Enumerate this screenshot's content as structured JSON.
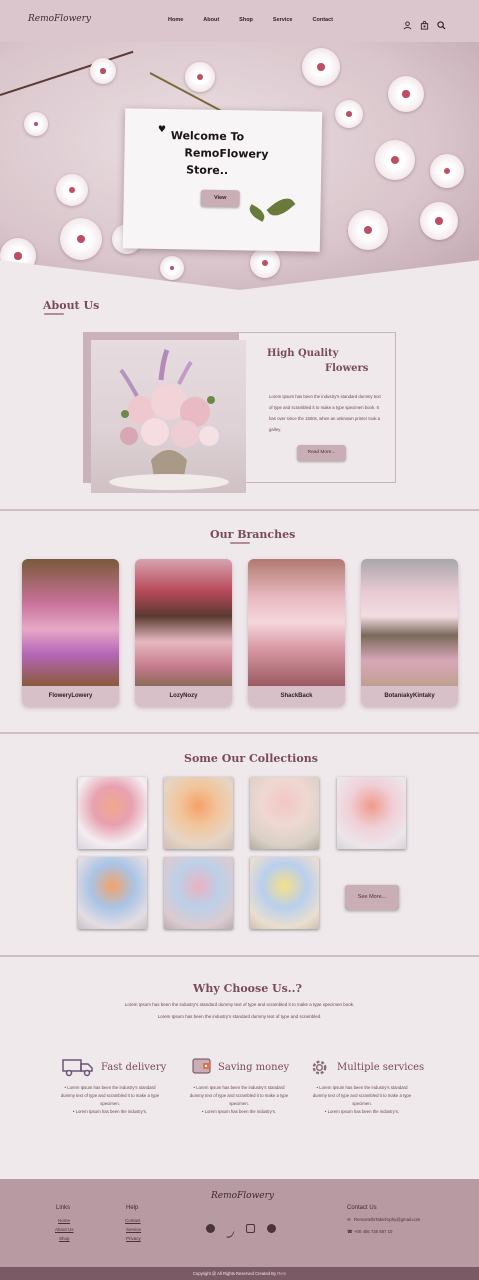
{
  "header": {
    "logo": "RemoFlowery",
    "nav": [
      "Home",
      "About",
      "Shop",
      "Service",
      "Contact"
    ],
    "icons": [
      "user-icon",
      "bag-icon",
      "search-icon"
    ]
  },
  "hero": {
    "welcome_line1": "Welcome To",
    "welcome_line2": "RemoFlowery",
    "welcome_line3": "Store..",
    "view_button": "View"
  },
  "about": {
    "title": "About Us",
    "heading_line1": "High Quality",
    "heading_line2": "Flowers",
    "text": "Lorem Ipsum has been the industry's standard dummy text of type and scrambled it to make a type specimen book. It has over since the 1500s, when an unknown printer took a galley.",
    "read_more": "Read More..."
  },
  "branches": {
    "title": "Our Branches",
    "items": [
      {
        "name": "FloweryLowery"
      },
      {
        "name": "LozyNozy"
      },
      {
        "name": "ShackBack"
      },
      {
        "name": "BotaniakyKintaky"
      }
    ]
  },
  "collections": {
    "title": "Some Our Collections",
    "see_more": "See More..."
  },
  "why": {
    "title": "Why Choose Us..?",
    "desc1": "Lorem Ipsum has been the industry's standard dummy text of type and scrambled it to make a type specimen book.",
    "desc2": "Lorem Ipsum has been the industry's standard dummy text of type and scrambled.",
    "features": [
      {
        "title": "Fast delivery",
        "icon": "truck-icon",
        "point1": "Lorem Ipsum has been the industry's standard dummy text of type and scrambled it to make a type specimen.",
        "point2": "Lorem Ipsum has been the industry's."
      },
      {
        "title": "Saving money",
        "icon": "wallet-icon",
        "point1": "Lorem Ipsum has been the industry's standard dummy text of type and scrambled it to make a type specimen.",
        "point2": "Lorem Ipsum has been the industry's."
      },
      {
        "title": "Multiple services",
        "icon": "gear-icon",
        "point1": "Lorem Ipsum has been the industry's standard dummy text of type and scrambled it to make a type specimen.",
        "point2": "Lorem Ipsum has been the industry's."
      }
    ]
  },
  "footer": {
    "logo": "RemoFlowery",
    "links_title": "Links",
    "links": [
      "Home",
      "About Us",
      "Shop"
    ],
    "help_title": "Help",
    "help": [
      "Contact",
      "Service",
      "Privacy"
    ],
    "contact_title": "Contact Us",
    "email": "RemoHelloTabelrophy@gmail.com",
    "phone": "+00 456 735 587 10",
    "socials": [
      "facebook-icon",
      "twitter-icon",
      "instagram-icon",
      "telegram-icon"
    ],
    "copyright": "Copyright @ All Rights Reserved Created By",
    "author": "Rem"
  },
  "colors": {
    "header_bg": "#dcc6cd",
    "page_bg": "#efe9ec",
    "accent": "#c9aeb6",
    "title": "#7a4a58",
    "footer_bg": "#b89aa3"
  }
}
